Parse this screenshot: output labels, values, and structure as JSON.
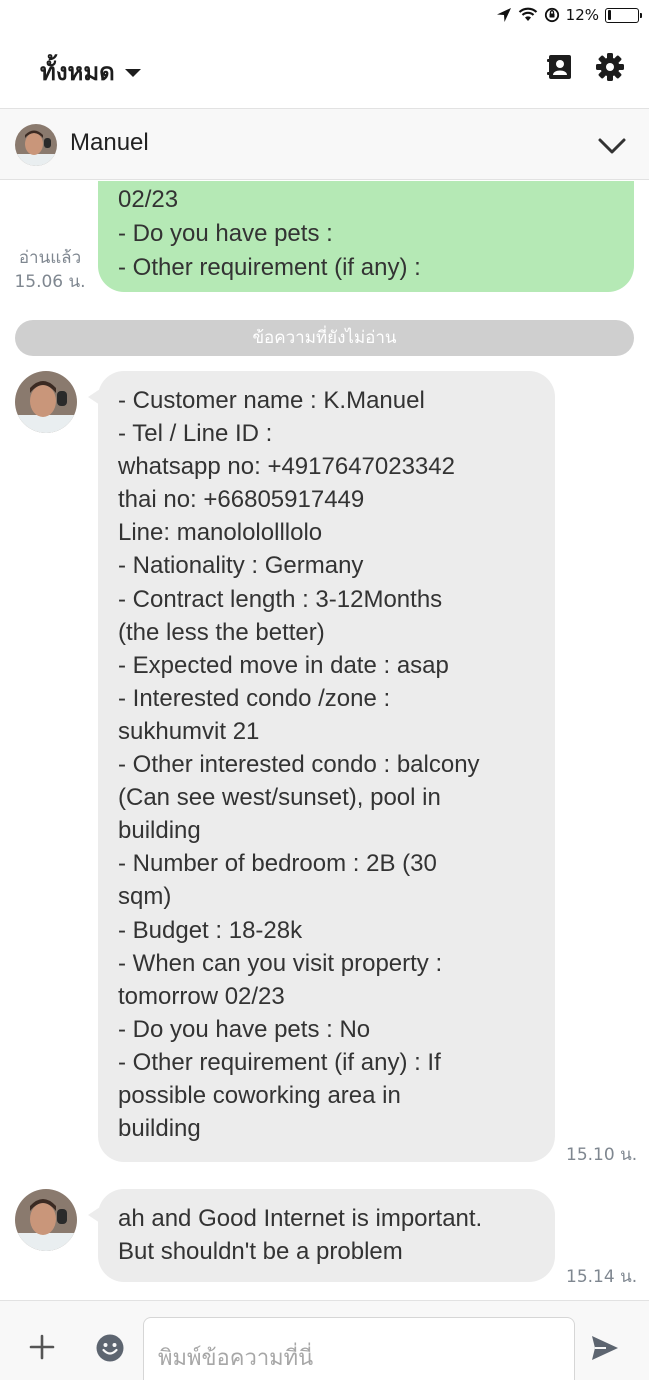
{
  "status_bar": {
    "battery": "12%",
    "battery_level": 0.12
  },
  "header": {
    "filter_label": "ทั้งหมด",
    "icons": [
      "contacts-icon",
      "gear-icon"
    ]
  },
  "chat": {
    "contact_name": "Manuel"
  },
  "messages": {
    "outgoing_partial": {
      "lines": [
        "02/23",
        "- Do you have pets :",
        "- Other requirement (if any) :"
      ],
      "read_label": "อ่านแล้ว",
      "time": "15.06 น."
    },
    "unread_divider": "ข้อความที่ยังไม่อ่าน",
    "incoming": [
      {
        "lines": [
          "- Customer name : K.Manuel",
          "- Tel / Line ID :",
          "whatsapp no: +4917647023342",
          "thai no: +66805917449",
          "Line: manolololllolo",
          "- Nationality : Germany",
          "- Contract length : 3-12Months",
          "(the less the better)",
          "- Expected move in date : asap",
          "- Interested condo /zone :",
          "sukhumvit 21",
          "- Other interested condo : balcony",
          "(Can see west/sunset), pool in",
          "building",
          "- Number of bedroom  : 2B (30",
          "sqm)",
          "- Budget : 18-28k",
          "- When can you visit property :",
          "tomorrow 02/23",
          "- Do you have pets : No",
          "- Other requirement (if any) : If",
          "possible coworking area in",
          "building"
        ],
        "time": "15.10 น."
      },
      {
        "lines": [
          "ah and Good Internet is important.",
          "But shouldn't be a problem"
        ],
        "time": "15.14 น."
      }
    ]
  },
  "input": {
    "placeholder": "พิมพ์ข้อความที่นี่"
  }
}
